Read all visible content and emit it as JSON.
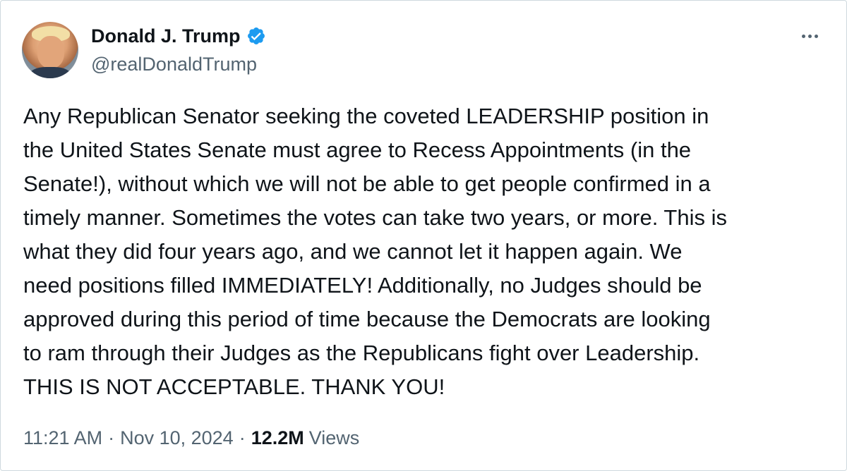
{
  "author": {
    "display_name": "Donald J. Trump",
    "handle": "@realDonaldTrump",
    "verified": true,
    "avatar_icon": "profile-photo"
  },
  "menu": {
    "more_icon": "more-horizontal-icon"
  },
  "tweet": {
    "text": "Any Republican Senator seeking the coveted LEADERSHIP position in\nthe United States Senate must agree to Recess Appointments (in the\nSenate!), without which we will not be able to get people confirmed in a\ntimely manner. Sometimes the votes can take two years, or more. This is\nwhat they did four years ago, and we cannot let it happen again. We\nneed positions filled IMMEDIATELY! Additionally, no Judges should be\napproved during this period of time because the Democrats are looking\nto ram through their Judges as the Republicans fight over Leadership.\nTHIS IS NOT ACCEPTABLE. THANK YOU!"
  },
  "meta": {
    "time": "11:21 AM",
    "separator": "·",
    "date": "Nov 10, 2024",
    "views_count": "12.2M",
    "views_label": "Views"
  },
  "colors": {
    "primary_text": "#0f1419",
    "secondary_text": "#536471",
    "verified_blue": "#1d9bf0",
    "border": "#cfd9de"
  }
}
